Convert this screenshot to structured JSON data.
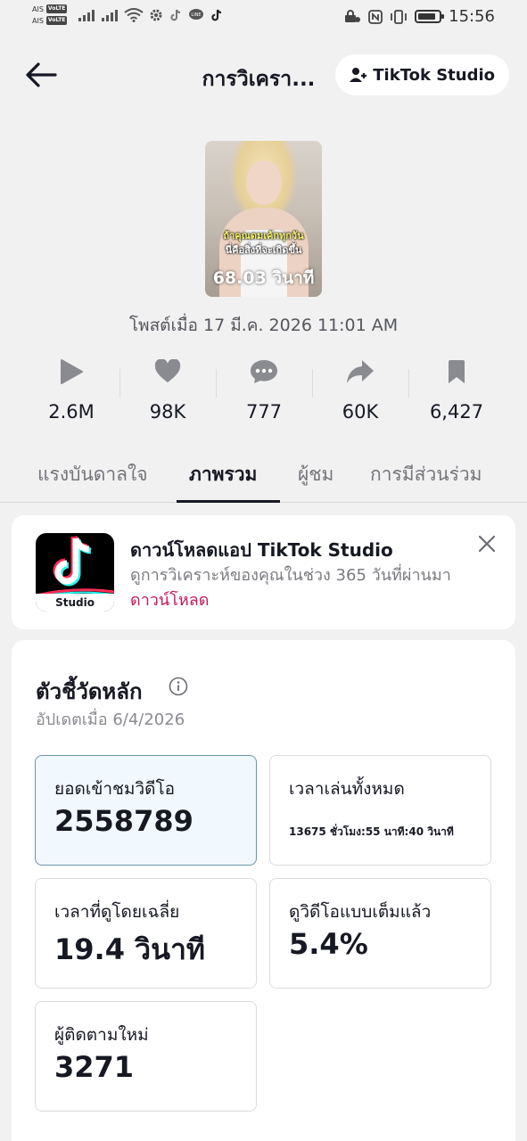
{
  "status_bar": {
    "carrier1": "AIS",
    "carrier2": "AIS",
    "volte": "VoLTE",
    "time": "15:56",
    "battery_level": 0.85
  },
  "header": {
    "title": "การวิเครา...",
    "studio_button": "TikTok Studio"
  },
  "video": {
    "caption_line1": "ถ้าคุณดมเค้กทุกวัน",
    "caption_line2": "นี่คือสิ่งที่จะเกิดขึ้น",
    "duration": "68.03 วินาที",
    "posted": "โพสต์เมื่อ 17 มี.ค. 2026 11:01 AM"
  },
  "stats": {
    "plays": "2.6M",
    "likes": "98K",
    "comments": "777",
    "shares": "60K",
    "saves": "6,427"
  },
  "tabs": {
    "inspiration": "แรงบันดาลใจ",
    "overview": "ภาพรวม",
    "viewers": "ผู้ชม",
    "engagement": "การมีส่วนร่วม"
  },
  "promo": {
    "logo_label": "Studio",
    "title": "ดาวน์โหลดแอป TikTok Studio",
    "description": "ดูการวิเคราะห์ของคุณในช่วง 365 วันที่ผ่านมา",
    "link": "ดาวน์โหลด"
  },
  "metrics": {
    "title": "ตัวชี้วัดหลัก",
    "updated": "อัปเดตเมื่อ 6/4/2026",
    "video_views_label": "ยอดเข้าชมวิดีโอ",
    "video_views_value": "2558789",
    "total_play_time_label": "เวลาเล่นทั้งหมด",
    "total_play_time_value": "13675 ชั่วโมง:55 นาที:40 วินาที",
    "avg_watch_time_label": "เวลาที่ดูโดยเฉลี่ย",
    "avg_watch_time_value": "19.4 วินาที",
    "full_watch_label": "ดูวิดีโอแบบเต็มแล้ว",
    "full_watch_value": "5.4%",
    "new_followers_label": "ผู้ติดตามใหม่",
    "new_followers_value": "3271"
  }
}
